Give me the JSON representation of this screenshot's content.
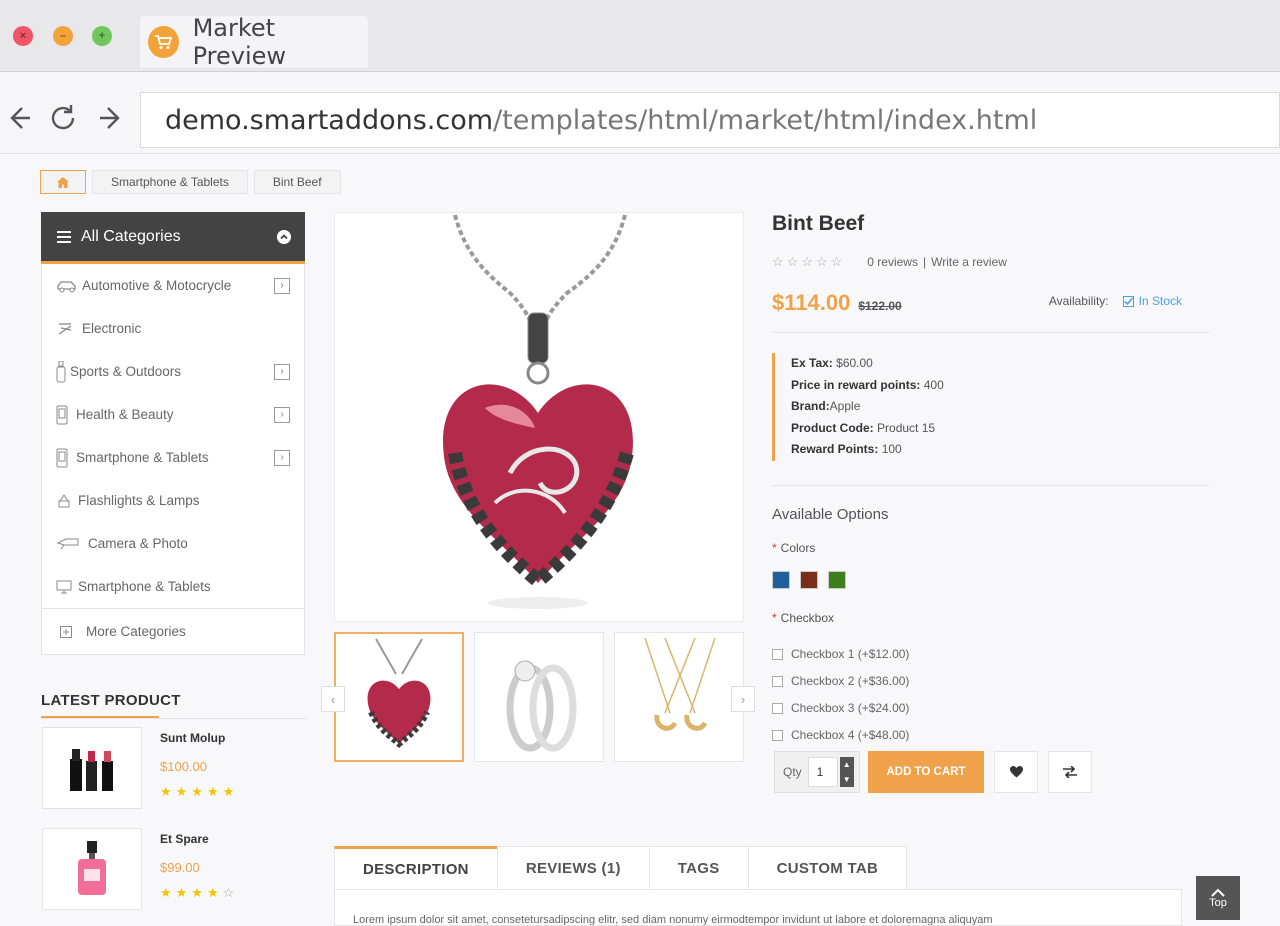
{
  "browser": {
    "tab_title": "Market Preview",
    "url_host": "demo.smartaddons.com",
    "url_path": "/templates/html/market/html/index.html"
  },
  "breadcrumb": [
    "Smartphone & Tablets",
    "Bint Beef"
  ],
  "sidebar": {
    "title": "All Categories",
    "items": [
      {
        "label": "Automotive & Motocrycle",
        "icon": "car-icon",
        "has_arrow": true
      },
      {
        "label": "Electronic",
        "icon": "electronic-icon",
        "has_arrow": false
      },
      {
        "label": "Sports & Outdoors",
        "icon": "bottle-icon",
        "has_arrow": true
      },
      {
        "label": "Health & Beauty",
        "icon": "phone-icon",
        "has_arrow": true
      },
      {
        "label": "Smartphone & Tablets",
        "icon": "smartphone-icon",
        "has_arrow": true
      },
      {
        "label": "Flashlights & Lamps",
        "icon": "lamp-icon",
        "has_arrow": false
      },
      {
        "label": "Camera & Photo",
        "icon": "camera-icon",
        "has_arrow": false
      },
      {
        "label": "Smartphone & Tablets",
        "icon": "monitor-icon",
        "has_arrow": false
      }
    ],
    "more": "More Categories"
  },
  "latest": {
    "title": "LATEST PRODUCT",
    "products": [
      {
        "name": "Sunt Molup",
        "price": "$100.00",
        "rating": 5
      },
      {
        "name": "Et Spare",
        "price": "$99.00",
        "rating": 4
      }
    ]
  },
  "product": {
    "title": "Bint Beef",
    "reviews_link": "0 reviews",
    "write_review": "Write a review",
    "price": "$114.00",
    "old_price": "$122.00",
    "availability_label": "Availability:",
    "availability_value": "In Stock",
    "specs": [
      {
        "label": "Ex Tax:",
        "value": "$60.00"
      },
      {
        "label": "Price in reward points:",
        "value": "400"
      },
      {
        "label": "Brand:",
        "value": "Apple"
      },
      {
        "label": "Product Code:",
        "value": "Product 15"
      },
      {
        "label": "Reward Points:",
        "value": "100"
      }
    ],
    "options_title": "Available Options",
    "colors_label": "Colors",
    "colors": [
      "#1f5f9e",
      "#7b2d1c",
      "#3c7d1e"
    ],
    "checkbox_label": "Checkbox",
    "checkboxes": [
      "Checkbox 1 (+$12.00)",
      "Checkbox 2 (+$36.00)",
      "Checkbox 3 (+$24.00)",
      "Checkbox 4 (+$48.00)"
    ],
    "qty_label": "Qty",
    "qty_value": "1",
    "add_to_cart": "ADD TO CART"
  },
  "tabs": [
    "DESCRIPTION",
    "REVIEWS (1)",
    "TAGS",
    "CUSTOM TAB"
  ],
  "description": "Lorem ipsum dolor sit amet, consetetursadipscing elitr, sed diam nonumy eirmodtempor invidunt ut labore et doloremagna aliquyam",
  "top_label": "Top",
  "accent_color": "#f0a24a"
}
